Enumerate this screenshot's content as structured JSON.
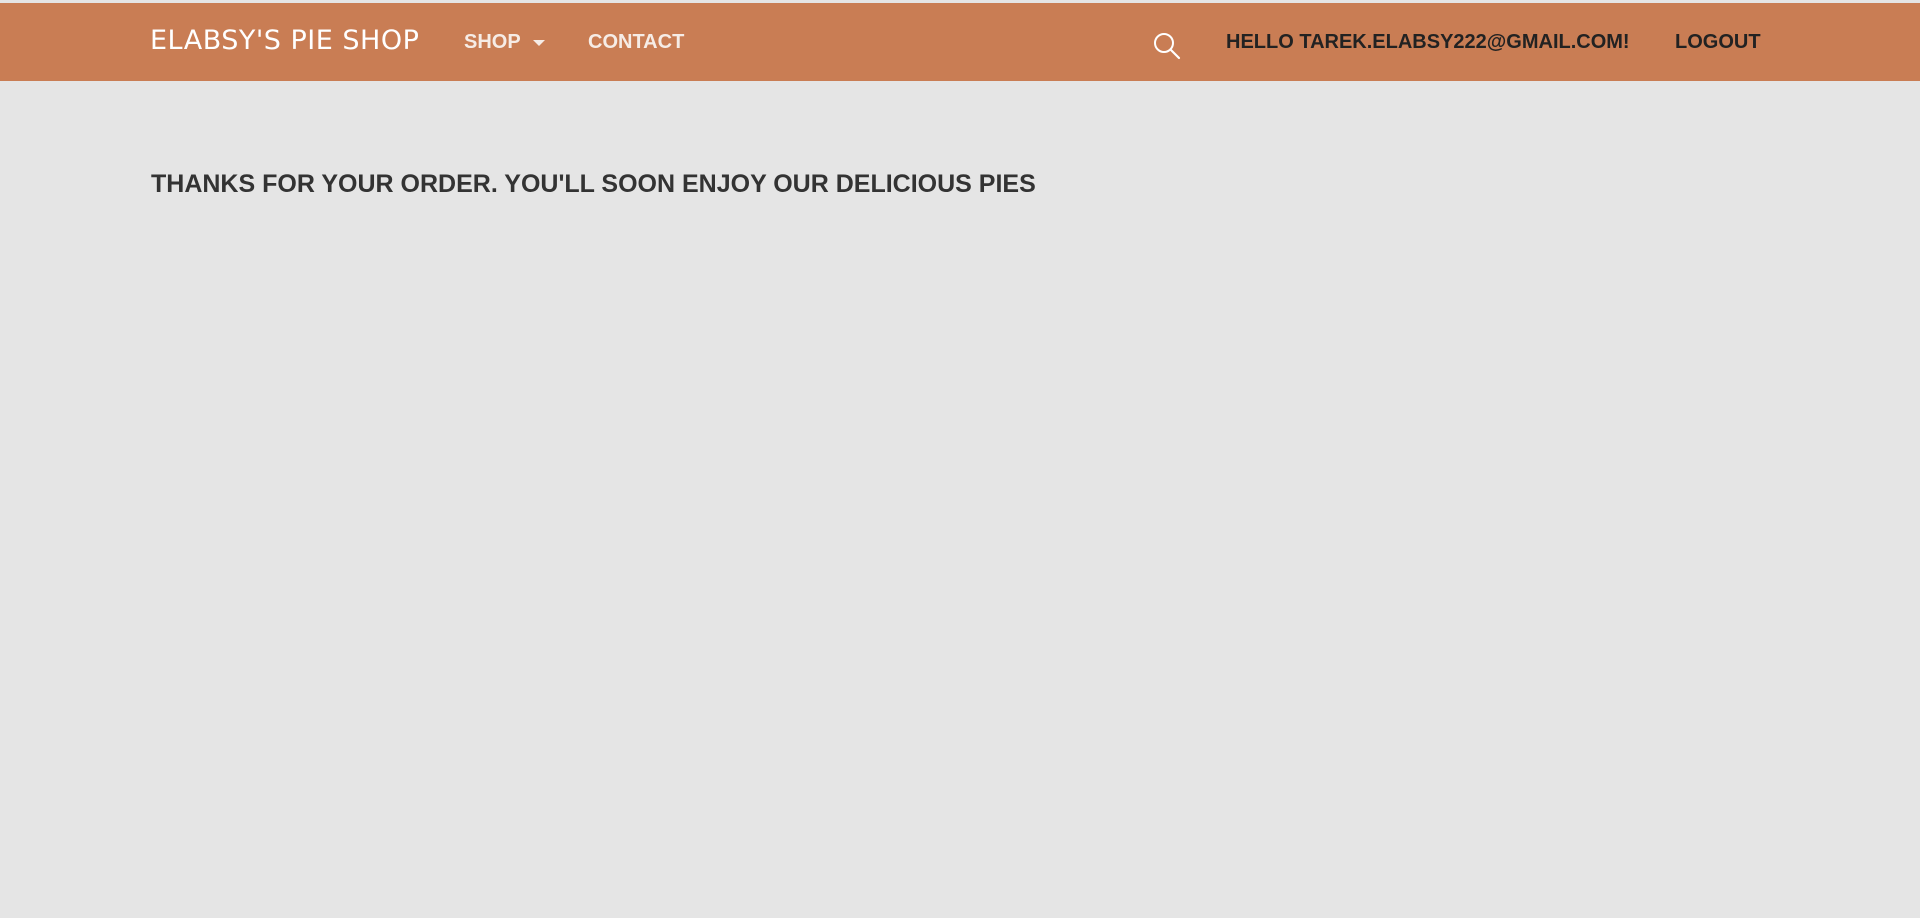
{
  "navbar": {
    "brand": "ELABSY'S PIE SHOP",
    "shop_label": "SHOP",
    "contact_label": "CONTACT",
    "search_icon": "search-icon",
    "greeting": "HELLO TAREK.ELABSY222@GMAIL.COM!",
    "logout_label": "LOGOUT",
    "background_color": "#c97d54"
  },
  "main": {
    "message": "THANKS FOR YOUR ORDER. YOU'LL SOON ENJOY OUR DELICIOUS PIES",
    "background_color": "#e5e5e5"
  }
}
